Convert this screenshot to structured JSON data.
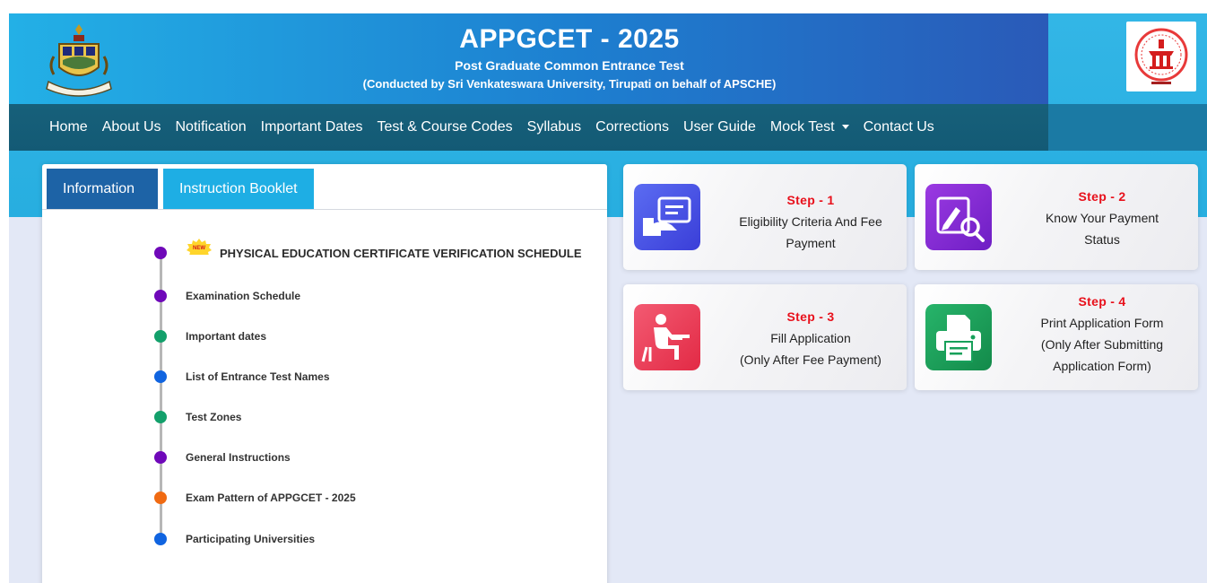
{
  "header": {
    "title": "APPGCET - 2025",
    "subtitle": "Post Graduate Common Entrance Test",
    "conducted_by": "(Conducted by Sri Venkateswara University, Tirupati on behalf of APSCHE)"
  },
  "nav": {
    "items": [
      "Home",
      "About Us",
      "Notification",
      "Important Dates",
      "Test & Course Codes",
      "Syllabus",
      "Corrections",
      "User Guide",
      "Mock Test",
      "Contact Us"
    ]
  },
  "tabs": {
    "information": "Information",
    "instruction_booklet": "Instruction Booklet"
  },
  "info_list": [
    {
      "label": "PHYSICAL EDUCATION CERTIFICATE VERIFICATION SCHEDULE",
      "color": "#6f08b9",
      "badge": "NEW"
    },
    {
      "label": "Examination Schedule",
      "color": "#6f08b9"
    },
    {
      "label": "Important dates",
      "color": "#13a06b"
    },
    {
      "label": "List of Entrance Test Names",
      "color": "#1064e0"
    },
    {
      "label": "Test Zones",
      "color": "#13a06b"
    },
    {
      "label": "General Instructions",
      "color": "#6f08b9"
    },
    {
      "label": "Exam Pattern of APPGCET - 2025",
      "color": "#f06a12"
    },
    {
      "label": "Participating Universities",
      "color": "#1064e0"
    }
  ],
  "steps": [
    {
      "label": "Step - 1",
      "line1": "Eligibility Criteria And Fee",
      "line2": "Payment",
      "line3": "",
      "icon": "card-payment-icon",
      "color": "#4a53e6"
    },
    {
      "label": "Step - 2",
      "line1": "Know Your Payment",
      "line2": "Status",
      "line3": "",
      "icon": "edit-search-icon",
      "color": "#8a2ad6"
    },
    {
      "label": "Step - 3",
      "line1": "Fill Application",
      "line2": "(Only After Fee Payment)",
      "line3": "",
      "icon": "student-desk-icon",
      "color": "#ee3d58"
    },
    {
      "label": "Step - 4",
      "line1": "Print Application Form",
      "line2": "(Only After Submitting",
      "line3": "Application Form)",
      "icon": "printer-icon",
      "color": "#17a05a"
    }
  ]
}
